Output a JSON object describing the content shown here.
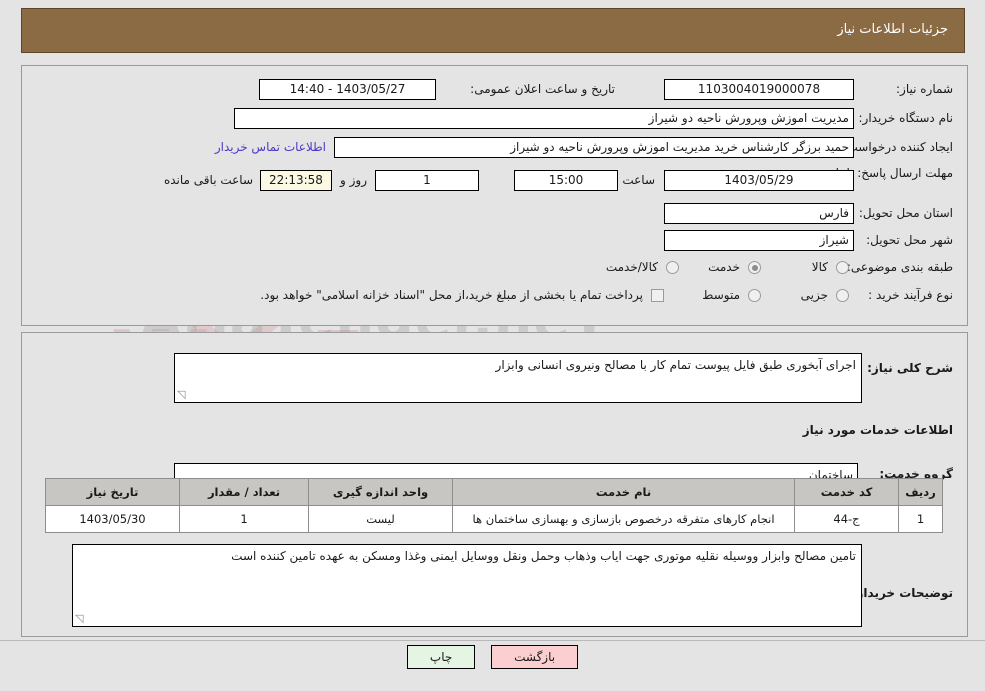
{
  "header": {
    "title": "جزئیات اطلاعات نیاز"
  },
  "watermark": {
    "text": "AriaTender.neT"
  },
  "top_panel": {
    "need_number_label": "شماره نیاز:",
    "need_number_value": "1103004019000078",
    "announce_datetime_label": "تاریخ و ساعت اعلان عمومی:",
    "announce_datetime_value": "1403/05/27 - 14:40",
    "buyer_org_label": "نام دستگاه خریدار:",
    "buyer_org_value": "مدیریت اموزش وپرورش ناحیه دو شیراز",
    "creator_label": "ایجاد کننده درخواست:",
    "creator_value": "حمید برزگر کارشناس خرید مدیریت اموزش وپرورش ناحیه دو شیراز",
    "contact_link": "اطلاعات تماس خریدار",
    "deadline_label": "مهلت ارسال پاسخ: تا تاریخ:",
    "deadline_date": "1403/05/29",
    "hour_label": "ساعت",
    "deadline_time": "15:00",
    "days_value": "1",
    "days_label": "روز و",
    "countdown_value": "22:13:58",
    "countdown_label": "ساعت باقی مانده",
    "province_label": "استان محل تحویل:",
    "province_value": "فارس",
    "city_label": "شهر محل تحویل:",
    "city_value": "شیراز",
    "category_label": "طبقه بندی موضوعی:",
    "category_options": [
      {
        "label": "کالا",
        "selected": false
      },
      {
        "label": "خدمت",
        "selected": true
      },
      {
        "label": "کالا/خدمت",
        "selected": false
      }
    ],
    "process_label": "نوع فرآیند خرید :",
    "process_options": [
      {
        "label": "جزیی",
        "selected": false
      },
      {
        "label": "متوسط",
        "selected": false
      }
    ],
    "treasury_checkbox_label": "پرداخت تمام یا بخشی از مبلغ خرید،از محل \"اسناد خزانه اسلامی\" خواهد بود.",
    "treasury_checked": false
  },
  "middle_panel": {
    "general_desc_label": "شرح کلی نیاز:",
    "general_desc_value": "اجرای آبخوری طبق فایل پیوست تمام کار با مصالح ونیروی انسانی وابزار",
    "services_heading": "اطلاعات خدمات مورد نیاز",
    "service_group_label": "گروه خدمت:",
    "service_group_value": "ساختمان",
    "buyer_notes_label": "توضیحات خریدار:",
    "buyer_notes_value": "تامین مصالح وابزار ووسیله نقلیه موتوری جهت ایاب وذهاب وحمل ونقل ووسایل ایمنی وغذا ومسکن به عهده تامین کننده است"
  },
  "table": {
    "columns": [
      "ردیف",
      "کد خدمت",
      "نام خدمت",
      "واحد اندازه گیری",
      "تعداد / مقدار",
      "تاریخ نیاز"
    ],
    "rows": [
      {
        "row": "1",
        "code": "ج-44",
        "name": "انجام کارهای متفرقه درخصوص بازسازی و بهسازی ساختمان ها",
        "unit": "لیست",
        "qty": "1",
        "date": "1403/05/30"
      }
    ]
  },
  "footer": {
    "print_label": "چاپ",
    "back_label": "بازگشت"
  }
}
